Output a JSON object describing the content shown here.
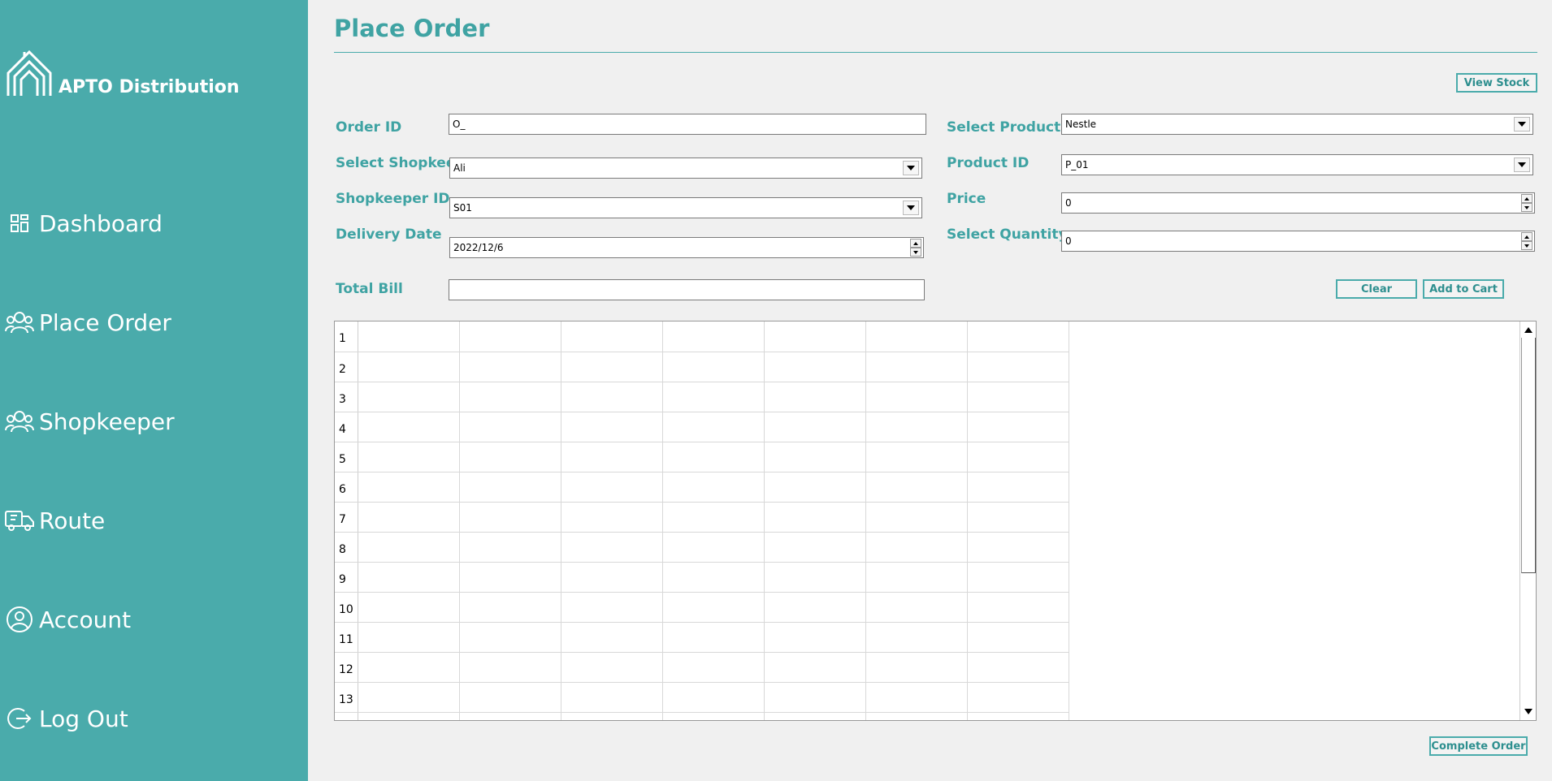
{
  "sidebar": {
    "brand": "APTO Distribution",
    "items": [
      {
        "label": "Dashboard",
        "icon": "dashboard-icon"
      },
      {
        "label": "Place Order",
        "icon": "people-icon"
      },
      {
        "label": "Shopkeeper",
        "icon": "people-icon"
      },
      {
        "label": "Route",
        "icon": "truck-icon"
      },
      {
        "label": "Account",
        "icon": "user-icon"
      },
      {
        "label": "Log Out",
        "icon": "logout-icon"
      }
    ]
  },
  "page": {
    "title": "Place Order"
  },
  "buttons": {
    "view_stock": "View Stock",
    "clear": "Clear",
    "add_to_cart": "Add to Cart",
    "complete_order": "Complete Order"
  },
  "form": {
    "order_id": {
      "label": "Order ID",
      "value": "O_"
    },
    "select_shopkee": {
      "label": "Select Shopkee",
      "value": "Ali"
    },
    "shopkeeper_id": {
      "label": "Shopkeeper ID",
      "value": "S01"
    },
    "delivery_date": {
      "label": "Delivery Date",
      "value": "2022/12/6"
    },
    "total_bill": {
      "label": "Total Bill",
      "value": ""
    },
    "select_product": {
      "label": "Select Product",
      "value": "Nestle"
    },
    "product_id": {
      "label": "Product ID",
      "value": "P_01"
    },
    "price": {
      "label": "Price",
      "value": "0"
    },
    "select_quantity": {
      "label": "Select Quantity",
      "value": "0"
    }
  },
  "table": {
    "row_numbers": [
      "1",
      "2",
      "3",
      "4",
      "5",
      "6",
      "7",
      "8",
      "9",
      "10",
      "11",
      "12",
      "13"
    ],
    "column_count": 7
  },
  "colors": {
    "sidebar": "#4aabab",
    "accent": "#3fa3a3",
    "background": "#f0f0f0"
  }
}
